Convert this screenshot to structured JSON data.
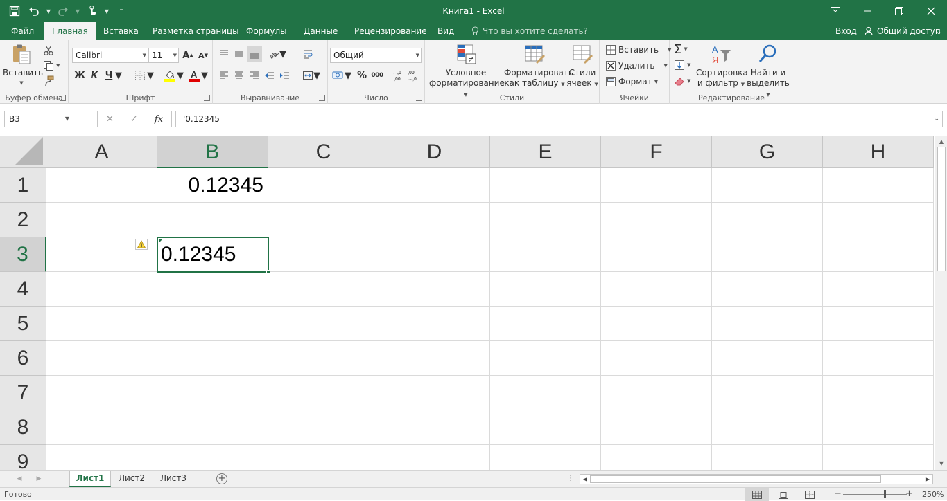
{
  "window": {
    "title": "Книга1 - Excel"
  },
  "tabs": {
    "file": "Файл",
    "home": "Главная",
    "insert": "Вставка",
    "page_layout": "Разметка страницы",
    "formulas": "Формулы",
    "data": "Данные",
    "review": "Рецензирование",
    "view": "Вид",
    "tell_me": "Что вы хотите сделать?",
    "sign_in": "Вход",
    "share": "Общий доступ"
  },
  "ribbon": {
    "clipboard": {
      "label": "Буфер обмена",
      "paste": "Вставить"
    },
    "font": {
      "label": "Шрифт",
      "font_name": "Calibri",
      "font_size": "11",
      "bold": "Ж",
      "italic": "К",
      "underline": "Ч"
    },
    "alignment": {
      "label": "Выравнивание"
    },
    "number": {
      "label": "Число",
      "format": "Общий"
    },
    "styles": {
      "label": "Стили",
      "conditional_line1": "Условное",
      "conditional_line2": "форматирование",
      "table_line1": "Форматировать",
      "table_line2": "как таблицу",
      "cell_styles_line1": "Стили",
      "cell_styles_line2": "ячеек"
    },
    "cells": {
      "label": "Ячейки",
      "insert": "Вставить",
      "delete": "Удалить",
      "format": "Формат"
    },
    "editing": {
      "label": "Редактирование",
      "sort_line1": "Сортировка",
      "sort_line2": "и фильтр",
      "find_line1": "Найти и",
      "find_line2": "выделить"
    }
  },
  "formula_bar": {
    "name_box": "B3",
    "formula": "'0.12345"
  },
  "grid": {
    "columns": [
      "A",
      "B",
      "C",
      "D",
      "E",
      "F",
      "G",
      "H"
    ],
    "rows": [
      "1",
      "2",
      "3",
      "4",
      "5",
      "6",
      "7",
      "8",
      "9"
    ],
    "selected_column": "B",
    "selected_row": "3",
    "cells": {
      "B1": "0.12345",
      "B3": "0.12345"
    }
  },
  "sheets": [
    "Лист1",
    "Лист2",
    "Лист3"
  ],
  "active_sheet": "Лист1",
  "status": {
    "ready": "Готово",
    "zoom": "250%"
  },
  "colors": {
    "accent": "#217346"
  }
}
